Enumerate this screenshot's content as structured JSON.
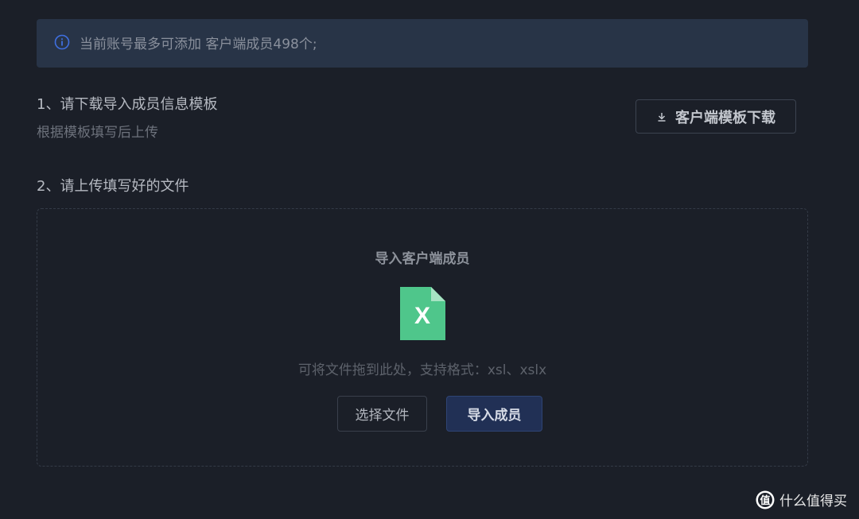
{
  "notice": {
    "text": "当前账号最多可添加 客户端成员498个;",
    "icon": "info-icon"
  },
  "step1": {
    "title": "1、请下载导入成员信息模板",
    "hint": "根据模板填写后上传",
    "download_button": "客户端模板下载"
  },
  "step2": {
    "title": "2、请上传填写好的文件"
  },
  "dropzone": {
    "title": "导入客户端成员",
    "file_icon_letter": "X",
    "hint": "可将文件拖到此处，支持格式：xsl、xslx",
    "choose_button": "选择文件",
    "import_button": "导入成员"
  },
  "watermark": {
    "text": "什么值得买"
  },
  "colors": {
    "accent": "#3f6fe0",
    "excel_green": "#4fc68b",
    "primary_button": "#213055"
  }
}
